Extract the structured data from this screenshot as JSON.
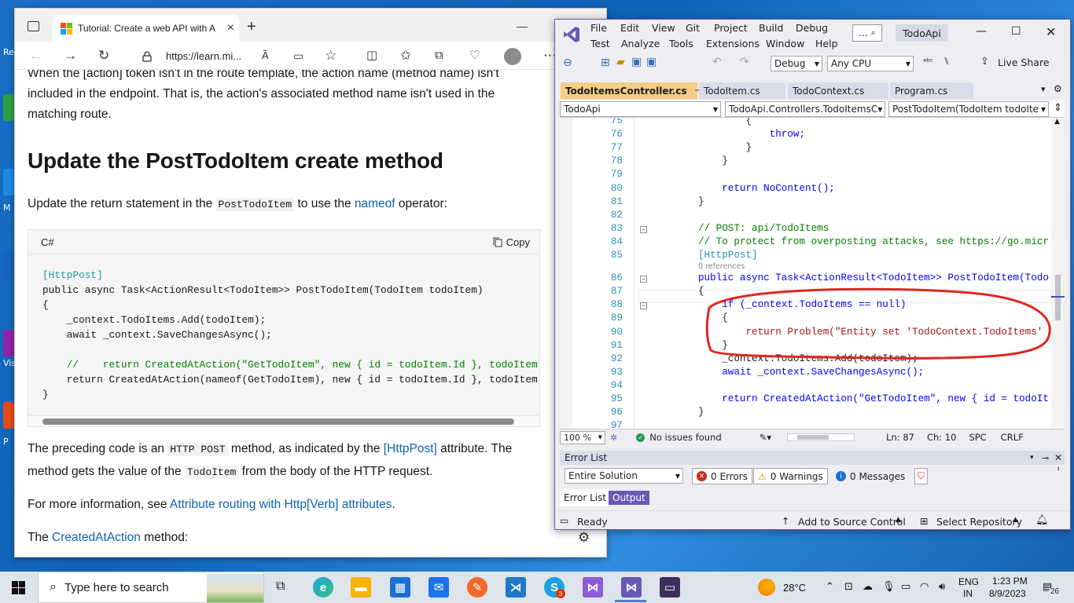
{
  "desktop": {
    "labels": [
      "Re",
      "M",
      "Vis",
      "P"
    ]
  },
  "browser": {
    "tab_title": "Tutorial: Create a web API with A",
    "tab_close": "×",
    "new_tab": "+",
    "url": "https://learn.mi...",
    "content": {
      "intro_p1": "When the [action] token isn't in the route template, the action name (method name) isn't",
      "intro_p2": "included in the endpoint. That is, the action's associated method name isn't used in the",
      "intro_p3": "matching route.",
      "heading": "Update the PostTodoItem create method",
      "update_pre": "Update the return statement in the",
      "update_code": "PostTodoItem",
      "update_mid": "to use the",
      "update_link": "nameof",
      "update_post": "operator:",
      "code_lang": "C#",
      "copy_label": "Copy",
      "code_lines": [
        "[HttpPost]",
        "public async Task<ActionResult<TodoItem>> PostTodoItem(TodoItem todoItem)",
        "{",
        "    _context.TodoItems.Add(todoItem);",
        "    await _context.SaveChangesAsync();",
        "",
        "    //    return CreatedAtAction(\"GetTodoItem\", new { id = todoItem.Id }, todoItem",
        "    return CreatedAtAction(nameof(GetTodoItem), new { id = todoItem.Id }, todoItem",
        "}"
      ],
      "preceding_pre": "The preceding code is an",
      "preceding_code1": "HTTP POST",
      "preceding_mid": "method, as indicated by the",
      "preceding_link": "[HttpPost]",
      "preceding_post": "attribute. The",
      "method_pre": "method gets the value of the",
      "method_code": "TodoItem",
      "method_post": "from the body of the HTTP request.",
      "more_pre": "For more information, see",
      "more_link": "Attribute routing with Http[Verb] attributes",
      "more_post": ".",
      "created_pre": "The",
      "created_link": "CreatedAtAction",
      "created_post": "method:"
    }
  },
  "vs": {
    "menu": {
      "file": "File",
      "edit": "Edit",
      "view": "View",
      "git": "Git",
      "project": "Project",
      "build": "Build",
      "debug": "Debug",
      "test": "Test",
      "analyze": "Analyze",
      "tools": "Tools",
      "extensions": "Extensions",
      "window": "Window",
      "help": "Help"
    },
    "search_label": "...",
    "title": "TodoApi",
    "toolbar": {
      "config": "Debug",
      "platform": "Any CPU",
      "live_share": "Live Share"
    },
    "tabs": [
      "TodoItemsController.cs",
      "TodoItem.cs",
      "TodoContext.cs",
      "Program.cs"
    ],
    "nav": {
      "project": "TodoApi",
      "class": "TodoApi.Controllers.TodoItemsC",
      "member": "PostTodoItem(TodoItem todoIte"
    },
    "code": [
      {
        "n": "75",
        "t": "        {"
      },
      {
        "n": "76",
        "t": "            throw;"
      },
      {
        "n": "77",
        "t": "        }"
      },
      {
        "n": "78",
        "t": "    }"
      },
      {
        "n": "79",
        "t": ""
      },
      {
        "n": "80",
        "t": "    return NoContent();"
      },
      {
        "n": "81",
        "t": "}"
      },
      {
        "n": "82",
        "t": ""
      },
      {
        "n": "83",
        "t": "// POST: api/TodoItems"
      },
      {
        "n": "84",
        "t": "// To protect from overposting attacks, see https://go.micr"
      },
      {
        "n": "85",
        "t": "[HttpPost]"
      },
      {
        "n": "86",
        "t": "public async Task<ActionResult<TodoItem>> PostTodoItem(Todo"
      },
      {
        "n": "87",
        "t": "{"
      },
      {
        "n": "88",
        "t": "    if (_context.TodoItems == null)"
      },
      {
        "n": "89",
        "t": "    {"
      },
      {
        "n": "90",
        "t": "        return Problem(\"Entity set 'TodoContext.TodoItems'  i"
      },
      {
        "n": "91",
        "t": "    }"
      },
      {
        "n": "92",
        "t": "    _context.TodoItems.Add(todoItem);"
      },
      {
        "n": "93",
        "t": "    await _context.SaveChangesAsync();"
      },
      {
        "n": "94",
        "t": ""
      },
      {
        "n": "95",
        "t": "    return CreatedAtAction(\"GetTodoItem\", new { id = todoIt"
      },
      {
        "n": "96",
        "t": "}"
      },
      {
        "n": "97",
        "t": ""
      }
    ],
    "references_hint": "0 references",
    "status_bar": {
      "zoom": "100 %",
      "issues": "No issues found",
      "ln": "Ln: 87",
      "ch": "Ch: 10",
      "spc": "SPC",
      "crlf": "CRLF"
    },
    "error_list": {
      "title": "Error List",
      "scope": "Entire Solution",
      "errors": "0 Errors",
      "warnings": "0 Warnings",
      "messages": "0 Messages",
      "tab_errors": "Error List",
      "tab_output": "Output"
    },
    "bottom_status": {
      "ready": "Ready",
      "source_control": "Add to Source Control",
      "repository": "Select Repository"
    }
  },
  "taskbar": {
    "search_placeholder": "Type here to search",
    "weather": "28°C",
    "lang1": "ENG",
    "lang2": "IN",
    "time": "1:23 PM",
    "date": "8/9/2023",
    "notif": "26",
    "skype_badge": "3"
  },
  "colors": {
    "vs_accent": "#6a58b6",
    "tab_active": "#f5cc84",
    "link": "#0f62b3",
    "annotation": "#e0261f"
  }
}
